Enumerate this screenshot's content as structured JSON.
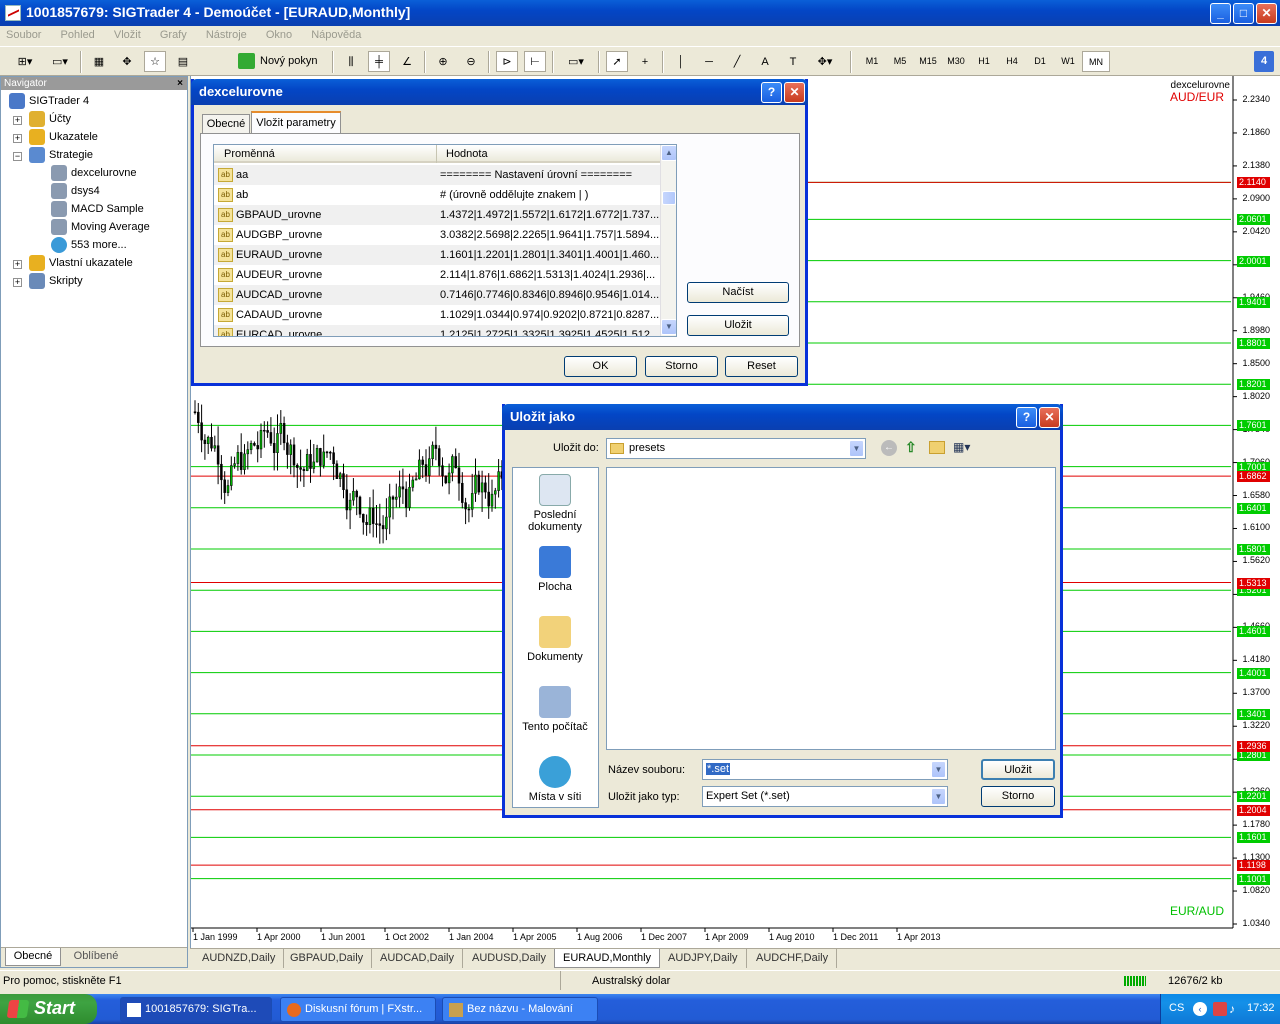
{
  "window": {
    "title": "1001857679: SIGTrader 4 - Demoúčet - [EURAUD,Monthly]"
  },
  "menu": [
    "Soubor",
    "Pohled",
    "Vložit",
    "Grafy",
    "Nástroje",
    "Okno",
    "Nápověda"
  ],
  "toolbar": {
    "new_order": "Nový pokyn",
    "timeframes": [
      "M1",
      "M5",
      "M15",
      "M30",
      "H1",
      "H4",
      "D1",
      "W1",
      "MN"
    ],
    "active_timeframe": "MN",
    "badge": "4"
  },
  "navigator": {
    "title": "Navigator",
    "items": [
      {
        "label": "SIGTrader 4",
        "icon": "terminal-icon"
      },
      {
        "label": "Účty",
        "icon": "accounts-icon"
      },
      {
        "label": "Ukazatele",
        "icon": "indicators-icon"
      },
      {
        "label": "Strategie",
        "icon": "experts-icon"
      },
      {
        "label": "dexcelurovne",
        "icon": "expert-icon"
      },
      {
        "label": "dsys4",
        "icon": "expert-icon"
      },
      {
        "label": "MACD Sample",
        "icon": "expert-icon"
      },
      {
        "label": "Moving Average",
        "icon": "expert-icon"
      },
      {
        "label": "553 more...",
        "icon": "globe-icon"
      },
      {
        "label": "Vlastní ukazatele",
        "icon": "custom-indicators-icon"
      },
      {
        "label": "Skripty",
        "icon": "scripts-icon"
      }
    ],
    "tabs": [
      "Obecné",
      "Oblíbené"
    ]
  },
  "chart": {
    "symbol_label": "dexcelurovne",
    "top_label": "AUD/EUR",
    "bottom_label": "EUR/AUD",
    "price_ticks": [
      "2.2340",
      "2.1860",
      "2.1380",
      "2.0900",
      "2.0420",
      "1.9940",
      "1.9460",
      "1.8980",
      "1.8500",
      "1.8020",
      "1.7540",
      "1.7060",
      "1.6580",
      "1.6100",
      "1.5620",
      "1.5140",
      "1.4660",
      "1.4180",
      "1.3700",
      "1.3220",
      "1.2740",
      "1.2260",
      "1.1780",
      "1.1300",
      "1.0820",
      "1.0340"
    ],
    "green_levels": [
      "2.1141",
      "2.0601",
      "2.0001",
      "1.9401",
      "1.8801",
      "1.8201",
      "1.7601",
      "1.7001",
      "1.6401",
      "1.5801",
      "1.5201",
      "1.4601",
      "1.4001",
      "1.3401",
      "1.2801",
      "1.2201",
      "1.1601",
      "1.1001"
    ],
    "red_levels": [
      "2.1140",
      "1.6862",
      "1.5313",
      "1.2936",
      "1.2004",
      "1.1198"
    ],
    "dates": [
      "1 Jan 1999",
      "1 Apr 2000",
      "1 Jun 2001",
      "1 Oct 2002",
      "1 Jan 2004",
      "1 Apr 2005",
      "1 Aug 2006",
      "1 Dec 2007",
      "1 Apr 2009",
      "1 Aug 2010",
      "1 Dec 2011",
      "1 Apr 2013"
    ]
  },
  "chart_tabs": [
    "AUDNZD,Daily",
    "GBPAUD,Daily",
    "AUDCAD,Daily",
    "AUDUSD,Daily",
    "EURAUD,Monthly",
    "AUDJPY,Daily",
    "AUDCHF,Daily"
  ],
  "active_chart_tab": "EURAUD,Monthly",
  "status": {
    "help": "Pro pomoc, stiskněte F1",
    "profile": "Australský dolar",
    "traffic": "12676/2 kb"
  },
  "params_dialog": {
    "title": "dexcelurovne",
    "tabs": [
      "Obecné",
      "Vložit parametry"
    ],
    "col_variable": "Proměnná",
    "col_value": "Hodnota",
    "rows": [
      {
        "name": "aa",
        "value": "======== Nastavení úrovní ========"
      },
      {
        "name": "ab",
        "value": "#  (úrovně oddělujte znakem | )"
      },
      {
        "name": "GBPAUD_urovne",
        "value": "1.4372|1.4972|1.5572|1.6172|1.6772|1.737..."
      },
      {
        "name": "AUDGBP_urovne",
        "value": "3.0382|2.5698|2.2265|1.9641|1.757|1.5894..."
      },
      {
        "name": "EURAUD_urovne",
        "value": "1.1601|1.2201|1.2801|1.3401|1.4001|1.460..."
      },
      {
        "name": "AUDEUR_urovne",
        "value": "2.114|1.876|1.6862|1.5313|1.4024|1.2936|..."
      },
      {
        "name": "AUDCAD_urovne",
        "value": "0.7146|0.7746|0.8346|0.8946|0.9546|1.014..."
      },
      {
        "name": "CADAUD_urovne",
        "value": "1.1029|1.0344|0.974|0.9202|0.8721|0.8287..."
      },
      {
        "name": "EURCAD_urovne",
        "value": "1.2125|1.2725|1.3325|1.3925|1.4525|1.512..."
      }
    ],
    "load_btn": "Načíst",
    "save_btn": "Uložit",
    "ok": "OK",
    "cancel": "Storno",
    "reset": "Reset"
  },
  "save_dialog": {
    "title": "Uložit jako",
    "save_in_label": "Uložit do:",
    "save_in_value": "presets",
    "places": [
      "Poslední dokumenty",
      "Plocha",
      "Dokumenty",
      "Tento počítač",
      "Místa v síti"
    ],
    "filename_label": "Název souboru:",
    "filename_value": "*.set",
    "type_label": "Uložit jako typ:",
    "type_value": "Expert Set (*.set)",
    "save_btn": "Uložit",
    "cancel_btn": "Storno"
  },
  "taskbar": {
    "start": "Start",
    "tasks": [
      "1001857679: SIGTra...",
      "Diskusní fórum | FXstr...",
      "Bez názvu - Malování"
    ],
    "lang": "CS",
    "time": "17:32"
  }
}
